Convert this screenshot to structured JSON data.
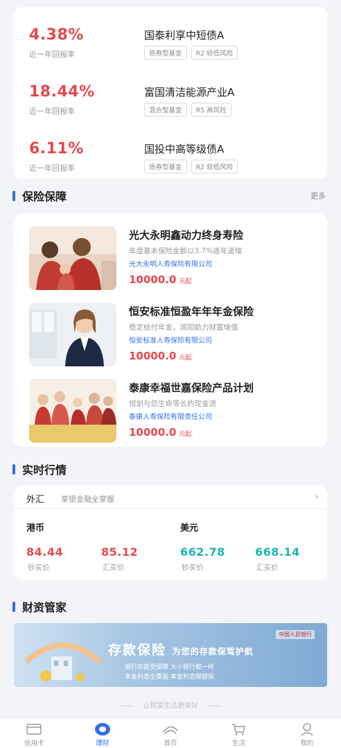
{
  "funds": [
    {
      "rate": "4.38%",
      "rate_label": "近一年回报率",
      "name": "国泰利享中短债A",
      "tags": [
        "债券型基金",
        "R2 较低风险"
      ]
    },
    {
      "rate": "18.44%",
      "rate_label": "近一年回报率",
      "name": "富国清洁能源产业A",
      "tags": [
        "混合型基金",
        "R5 高风险"
      ]
    },
    {
      "rate": "6.11%",
      "rate_label": "近一年回报率",
      "name": "国投中高等级债A",
      "tags": [
        "债券型基金",
        "R2 较低风险"
      ]
    }
  ],
  "insurance_section": {
    "title": "保险保障",
    "more": "更多"
  },
  "insurance": [
    {
      "name": "光大永明鑫动力终身寿险",
      "desc": "年度基本保险金额以3.7%逐年递增",
      "company": "光大永明人寿保险有限公司",
      "price": "10000.0",
      "unit": "元起",
      "image": "family-photo"
    },
    {
      "name": "恒安标准恒盈年年年金保险",
      "desc": "稳定给付年金，润阳助力财富增值",
      "company": "恒安标准人寿保险有限公司",
      "price": "10000.0",
      "unit": "元起",
      "image": "businesswoman-photo"
    },
    {
      "name": "泰康幸福世嘉保险产品计划",
      "desc": "规划与您生命等长的现金流",
      "company": "泰康人寿保险有限责任公司",
      "price": "10000.0",
      "unit": "元起",
      "image": "multigeneration-family-photo"
    }
  ],
  "market_section": {
    "title": "实时行情"
  },
  "market": {
    "tab": "外汇",
    "subtitle": "掌银金融全掌握",
    "currencies": [
      {
        "name": "港币",
        "buy_cash": "84.44",
        "buy_cash_label": "钞买价",
        "buy_transfer": "85.12",
        "buy_transfer_label": "汇买价",
        "color": "#e5484d"
      },
      {
        "name": "美元",
        "buy_cash": "662.78",
        "buy_cash_label": "钞买价",
        "buy_transfer": "668.14",
        "buy_transfer_label": "汇买价",
        "color": "#18b8b0"
      }
    ]
  },
  "wealth_section": {
    "title": "财资管家"
  },
  "banner": {
    "title": "存款保险",
    "subtitle": "为您的存款保驾护航",
    "line1": "银行存款受保障  大小银行都一样",
    "line2": "本金利息全覆盖  本金利息限额保",
    "brand": "中国人民银行"
  },
  "slogan": "让财富生活更美好",
  "nav": [
    {
      "label": "信用卡",
      "icon": "card-icon",
      "active": false
    },
    {
      "label": "理财",
      "icon": "wealth-icon",
      "active": true
    },
    {
      "label": "首页",
      "icon": "home-icon",
      "active": false
    },
    {
      "label": "生活",
      "icon": "cart-icon",
      "active": false
    },
    {
      "label": "我的",
      "icon": "user-icon",
      "active": false
    }
  ],
  "colors": {
    "accent": "#2f6fe8",
    "rise": "#e5484d",
    "teal": "#18b8b0"
  }
}
